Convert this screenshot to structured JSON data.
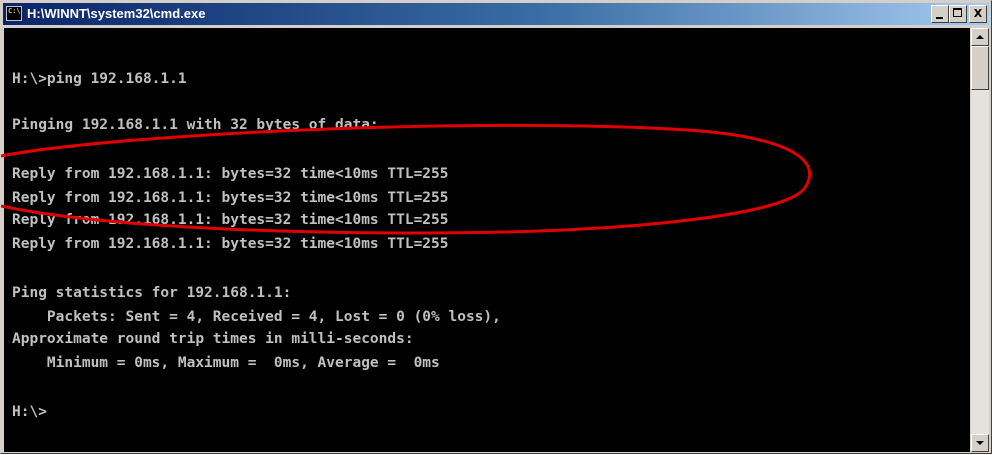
{
  "window": {
    "title": "H:\\WINNT\\system32\\cmd.exe",
    "icon_text": "C:\\"
  },
  "controls": {
    "minimize_icon": "minimize-icon",
    "maximize_icon": "maximize-icon",
    "close_label": "X"
  },
  "console": {
    "foreground": "#c0c0c0",
    "background": "#000000",
    "lines": [
      "H:\\>ping 192.168.1.1",
      "Pinging 192.168.1.1 with 32 bytes of data:",
      "Reply from 192.168.1.1: bytes=32 time<10ms TTL=255",
      "Reply from 192.168.1.1: bytes=32 time<10ms TTL=255",
      "Reply from 192.168.1.1: bytes=32 time<10ms TTL=255",
      "Reply from 192.168.1.1: bytes=32 time<10ms TTL=255",
      "Ping statistics for 192.168.1.1:",
      "    Packets: Sent = 4, Received = 4, Lost = 0 (0% loss),",
      "Approximate round trip times in milli-seconds:",
      "    Minimum = 0ms, Maximum =  0ms, Average =  0ms",
      "H:\\>"
    ]
  },
  "annotation": {
    "shape": "ellipse",
    "color": "#e00000",
    "highlights": "reply lines"
  },
  "colors": {
    "titlebar_start": "#0a246a",
    "titlebar_end": "#a6caf0",
    "chrome": "#d4d0c8"
  }
}
